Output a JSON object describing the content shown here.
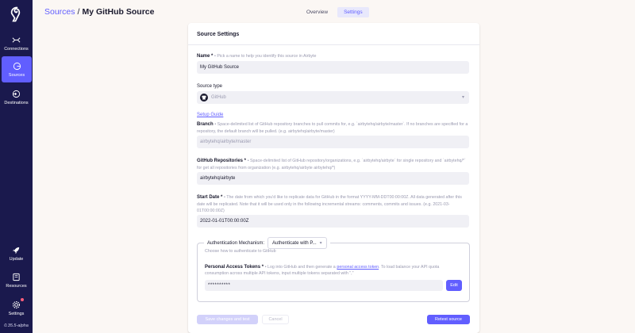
{
  "sidebar": {
    "items": [
      {
        "label": "Connections",
        "icon": "connections-icon"
      },
      {
        "label": "Sources",
        "icon": "sources-icon",
        "active": true
      },
      {
        "label": "Destinations",
        "icon": "destinations-icon"
      }
    ],
    "bottom_items": [
      {
        "label": "Update",
        "icon": "rocket-icon"
      },
      {
        "label": "Resources",
        "icon": "book-icon"
      },
      {
        "label": "Settings",
        "icon": "gear-icon"
      }
    ],
    "version": "0.35.5-alpha"
  },
  "header": {
    "breadcrumb_link": "Sources",
    "breadcrumb_sep": "/",
    "breadcrumb_current": "My GitHub Source",
    "tabs": [
      {
        "label": "Overview"
      },
      {
        "label": "Settings",
        "active": true
      }
    ]
  },
  "form": {
    "title": "Source Settings",
    "name": {
      "label": "Name *",
      "help": "• Pick a name to help you identify this source in Airbyte",
      "value": "My GitHub Source"
    },
    "source_type": {
      "label": "Source type",
      "value": "GitHub",
      "setup_guide": "Setup Guide"
    },
    "branch": {
      "label": "Branch",
      "help": "• Space-delimited list of GitHub repository branches to pull commits for, e.g. `airbytehq/airbyte/master`. If no branches are specified for a repository, the default branch will be pulled. (e.g. airbytehq/airbyte/master)",
      "placeholder": "airbytehq/airbyte/master"
    },
    "repositories": {
      "label": "GitHub Repositories *",
      "help": "• Space-delimited list of GitHub repository/organizations, e.g. `airbytehq/airbyte` for single repository and `airbytehq/*` for get all repositories from organization (e.g. airbytehq/airbyte airbytehq/*)",
      "value": "airbytehq/airbyte"
    },
    "start_date": {
      "label": "Start Date *",
      "help": "• The date from which you'd like to replicate data for GitHub in the format YYYY-MM-DDT00:00:00Z. All data generated after this date will be replicated. Note that it will be used only in the following incremental streams: comments, commits and issues. (e.g. 2021-03-01T00:00:00Z)",
      "value": "2022-01-01T00:00:00Z"
    },
    "auth": {
      "label": "Authentication Mechanism:",
      "selected": "Authenticate with P...",
      "help": "Choose how to authenticate to GitHub",
      "pat_label": "Personal Access Tokens *",
      "pat_help_pre": "• Log into GitHub and then generate a",
      "pat_link": "personal access token",
      "pat_help_post": ". To load balance your API quota consumption across multiple API tokens, input multiple tokens separated with \",\"",
      "pat_value": "**********",
      "edit_label": "Edit"
    }
  },
  "buttons": {
    "save": "Save changes and test",
    "cancel": "Cancel",
    "retest": "Retest source"
  },
  "colors": {
    "sidebar_bg": "#1a194d",
    "accent": "#615eff",
    "page_bg": "#fbf7f4"
  }
}
